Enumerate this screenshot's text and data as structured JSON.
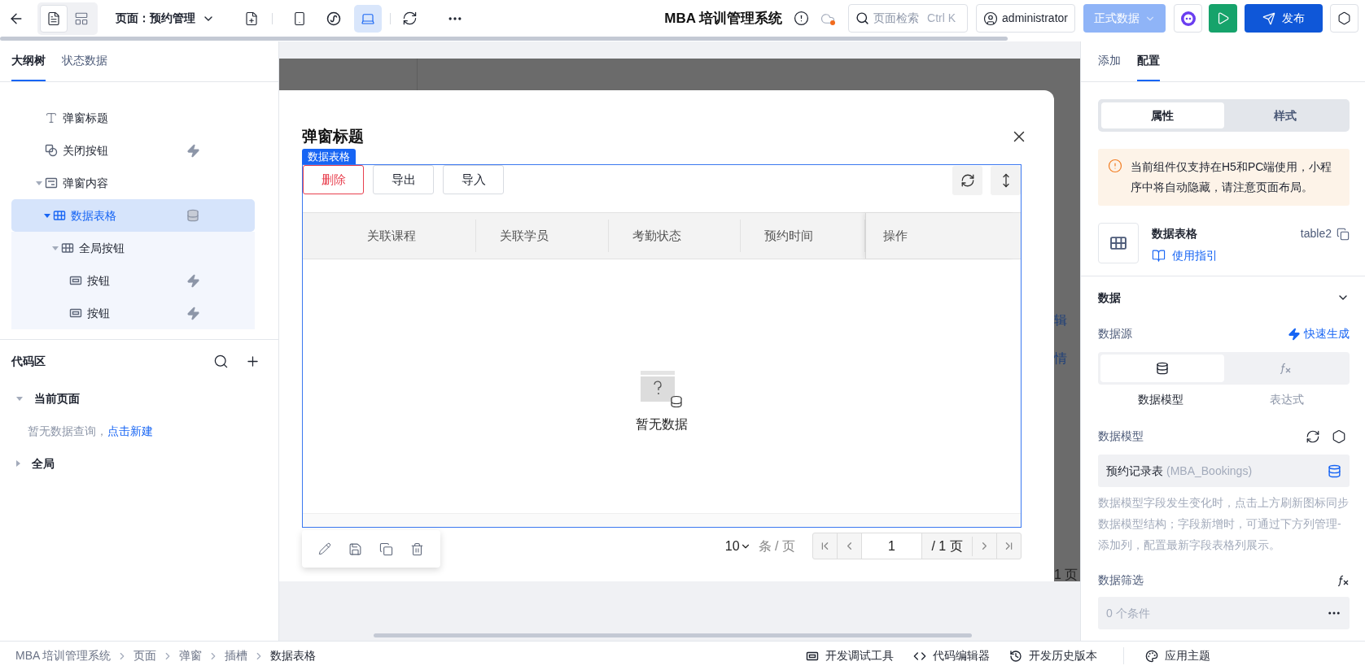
{
  "top_bar": {
    "view_modes": [
      {
        "kind": "outline",
        "selected": true
      },
      {
        "kind": "layout",
        "selected": false
      }
    ],
    "page_selector": "页面：预约管理",
    "devices": [
      {
        "kind": "mobile",
        "selected": false
      },
      {
        "kind": "miniprogram",
        "selected": false
      },
      {
        "kind": "desktop",
        "selected": true
      }
    ],
    "app_title": "MBA 培训管理系统",
    "search": {
      "placeholder": "页面检索",
      "shortcut": "Ctrl K"
    },
    "user": "administrator",
    "environment": {
      "label": "正式数据",
      "disabled": true
    },
    "publish": "发布"
  },
  "left_panel": {
    "tabs": [
      {
        "label": "大纲树",
        "selected": true
      },
      {
        "label": "状态数据",
        "selected": false
      }
    ],
    "tree": [
      {
        "label": "弹窗标题",
        "kind": "text",
        "selected": false
      },
      {
        "label": "关闭按钮",
        "kind": "shape",
        "selected": false,
        "event_bound": true
      },
      {
        "label": "弹窗内容",
        "kind": "container",
        "selected": false,
        "expanded": true,
        "children": [
          {
            "label": "数据表格",
            "kind": "table",
            "selected": true,
            "expanded": true,
            "data_bound": true,
            "children": [
              {
                "label": "全局按钮",
                "kind": "table",
                "selected": false,
                "expanded": true,
                "children": [
                  {
                    "label": "按钮",
                    "kind": "button",
                    "selected": false,
                    "event_bound": true
                  },
                  {
                    "label": "按钮",
                    "kind": "button",
                    "selected": false,
                    "event_bound": true
                  }
                ]
              }
            ]
          }
        ]
      }
    ],
    "code_area": {
      "title": "代码区",
      "groups": [
        {
          "label": "当前页面",
          "expanded": true,
          "empty_text": "暂无数据查询，",
          "empty_link": "点击新建"
        },
        {
          "label": "全局",
          "expanded": false
        }
      ]
    }
  },
  "canvas": {
    "background_texts": [
      "辑",
      "情",
      "1 页"
    ],
    "modal": {
      "title": "弹窗标题",
      "selection_tag": "数据表格",
      "toolbar": [
        {
          "label": "删除",
          "kind": "danger"
        },
        {
          "label": "导出",
          "kind": "default"
        },
        {
          "label": "导入",
          "kind": "default"
        }
      ],
      "columns": [
        "关联课程",
        "关联学员",
        "考勤状态",
        "预约时间",
        "操作"
      ],
      "empty_text": "暂无数据",
      "pagination": {
        "page_size": "10",
        "unit": "条 / 页",
        "page": "1",
        "total": "/ 1 页"
      }
    }
  },
  "right_panel": {
    "tabs": [
      {
        "label": "添加",
        "selected": false
      },
      {
        "label": "配置",
        "selected": true
      }
    ],
    "segments": [
      {
        "label": "属性",
        "selected": true
      },
      {
        "label": "样式",
        "selected": false
      }
    ],
    "warning": "当前组件仅支持在H5和PC端使用，小程序中将自动隐藏，请注意页面布局。",
    "component": {
      "name": "数据表格",
      "id": "table2",
      "guide": "使用指引"
    },
    "section": {
      "title": "数据",
      "expanded": true
    },
    "data_source": {
      "label": "数据源",
      "action": "快速生成",
      "options": [
        {
          "label": "数据模型",
          "kind": "model",
          "selected": true
        },
        {
          "label": "表达式",
          "kind": "expression",
          "selected": false
        }
      ]
    },
    "data_model": {
      "label": "数据模型",
      "value": "预约记录表",
      "value_code": "(MBA_Bookings)",
      "help": "数据模型字段发生变化时，点击上方刷新图标同步数据模型结构；字段新增时，可通过下方列管理-添加列，配置最新字段表格列展示。"
    },
    "filter": {
      "label": "数据筛选",
      "value": "0 个条件"
    }
  },
  "status_bar": {
    "breadcrumb": [
      "MBA 培训管理系统",
      "页面",
      "弹窗",
      "插槽",
      "数据表格"
    ],
    "tools": [
      {
        "kind": "debug",
        "label": "开发调试工具"
      },
      {
        "kind": "code",
        "label": "代码编辑器"
      },
      {
        "kind": "history",
        "label": "开发历史版本"
      },
      {
        "kind": "theme",
        "label": "应用主题"
      }
    ]
  }
}
